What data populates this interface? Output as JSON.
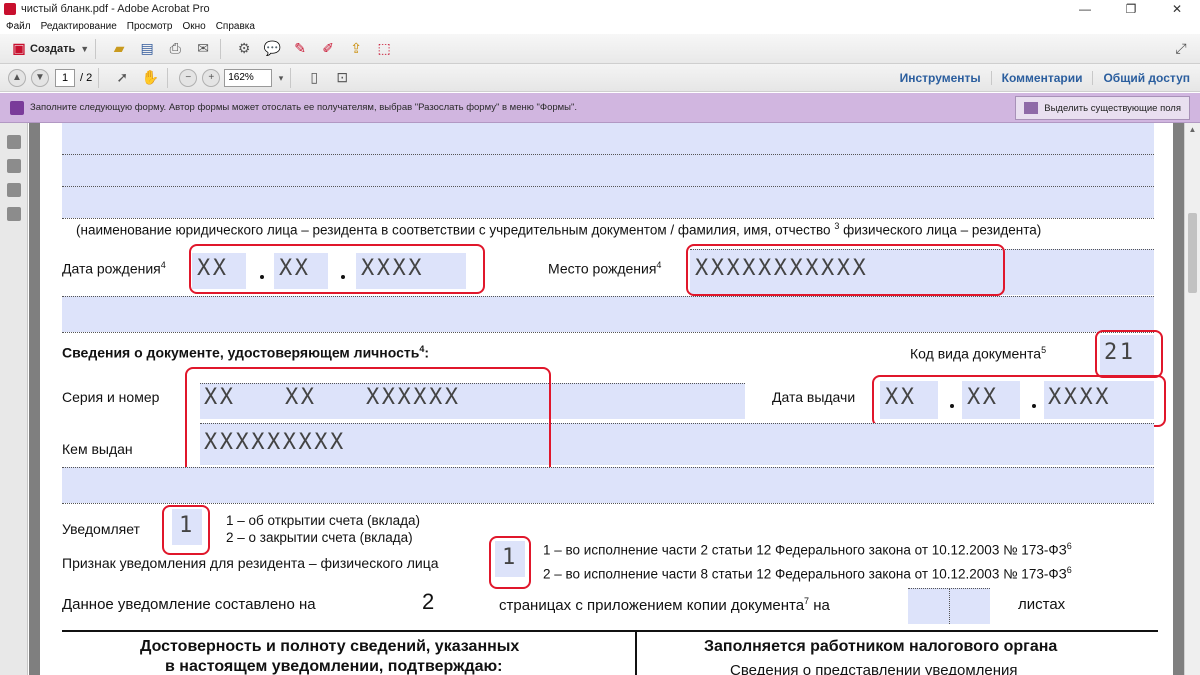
{
  "window": {
    "title": "чистый бланк.pdf - Adobe Acrobat Pro"
  },
  "menu": [
    "Файл",
    "Редактирование",
    "Просмотр",
    "Окно",
    "Справка"
  ],
  "toolbar": {
    "create_label": "Создать"
  },
  "navbar": {
    "page_current": "1",
    "page_total": "/ 2",
    "zoom": "162%",
    "right_tabs": [
      "Инструменты",
      "Комментарии",
      "Общий доступ"
    ]
  },
  "formbar": {
    "message": "Заполните следующую форму. Автор формы может отослать ее получателям, выбрав \"Разослать форму\" в меню \"Формы\".",
    "highlight_button": "Выделить существующие поля"
  },
  "doc": {
    "name_caption": "(наименование юридического лица – резидента в соответствии с учредительным документом / фамилия, имя, отчество",
    "name_caption_sup": "3",
    "name_caption_tail": "физического лица – резидента)",
    "dob_label": "Дата рождения",
    "dob_sup": "4",
    "dob_day": "XX",
    "dob_month": "XX",
    "dob_year": "XXXX",
    "pob_label": "Место рождения",
    "pob_sup": "4",
    "pob_value": "XXXXXXXXXXX",
    "id_heading": "Сведения о документе, удостоверяющем личность",
    "id_heading_sup": "4",
    "id_heading_colon": ":",
    "doc_type_label": "Код вида документа",
    "doc_type_sup": "5",
    "doc_type_value": "21",
    "series_label": "Серия и номер",
    "series_a": "XX",
    "series_b": "XX",
    "series_c": "XXXXXX",
    "issue_date_label": "Дата выдачи",
    "issue_day": "XX",
    "issue_month": "XX",
    "issue_year": "XXXX",
    "issued_by_label": "Кем выдан",
    "issued_by_value": "XXXXXXXXX",
    "notify_label": "Уведомляет",
    "notify_value": "1",
    "notify_opt1": "1 – об открытии счета (вклада)",
    "notify_opt2": "2 – о закрытии счета (вклада)",
    "sign_label": "Признак уведомления для резидента – физического лица",
    "sign_value": "1",
    "sign_opt1": "1 – во исполнение части 2 статьи 12 Федерального закона от 10.12.2003 № 173-ФЗ",
    "sign_opt1_sup": "6",
    "sign_opt2": "2 – во исполнение части 8 статьи 12 Федерального закона от 10.12.2003 № 173-ФЗ",
    "sign_opt2_sup": "6",
    "pages_label": "Данное уведомление составлено на",
    "pages_value": "2",
    "pages_mid": "страницах с приложением копии документа",
    "pages_mid_sup": "7",
    "pages_na": "на",
    "sheets_label": "листах",
    "footer_left_1": "Достоверность и полноту сведений, указанных",
    "footer_left_2": "в настоящем уведомлении, подтверждаю:",
    "footer_right_1": "Заполняется работником налогового органа",
    "footer_right_2": "Сведения о представлении уведомления"
  }
}
